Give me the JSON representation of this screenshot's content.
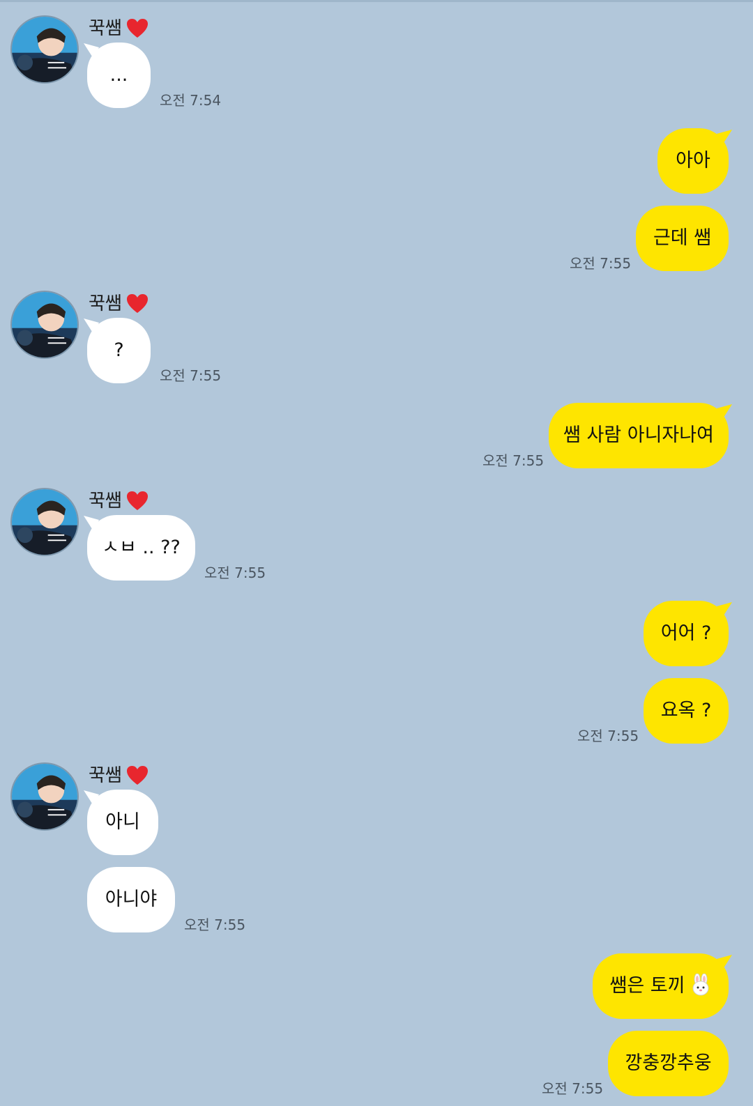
{
  "contact": {
    "name": "꾹쌤"
  },
  "messages_in": [
    {
      "text": "...",
      "time": "오전 7:54"
    },
    {
      "text": "?",
      "time": "오전 7:55"
    },
    {
      "text": "ㅅㅂ .. ??",
      "time": "오전 7:55"
    },
    {
      "text": "아니",
      "time": ""
    },
    {
      "text": "아니야",
      "time": "오전 7:55"
    }
  ],
  "messages_out": [
    {
      "text": "아아",
      "time": ""
    },
    {
      "text": "근데 쌤",
      "time": "오전 7:55"
    },
    {
      "text": "쌤 사람 아니자나여",
      "time": "오전 7:55"
    },
    {
      "text": "어어 ?",
      "time": ""
    },
    {
      "text": "요옥 ?",
      "time": "오전 7:55"
    },
    {
      "text": "쌤은 토끼",
      "time": ""
    },
    {
      "text": "깡충깡추웅",
      "time": "오전 7:55"
    }
  ],
  "colors": {
    "background": "#b2c7da",
    "outgoing_bubble": "#fee500",
    "incoming_bubble": "#ffffff"
  },
  "icons": {
    "heart": "heart-icon",
    "rabbit": "rabbit-icon",
    "avatar": "avatar"
  }
}
